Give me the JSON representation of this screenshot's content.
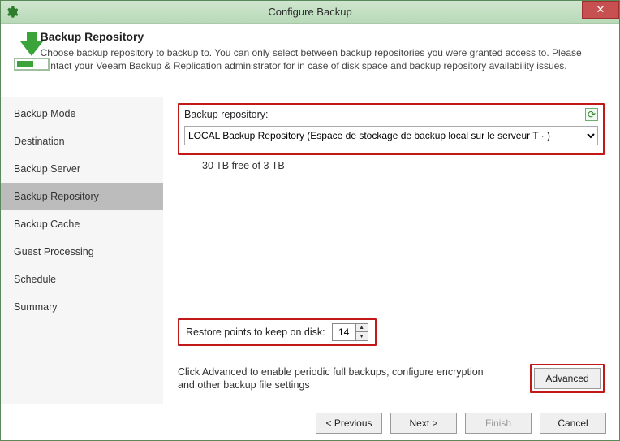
{
  "window": {
    "title": "Configure Backup"
  },
  "header": {
    "title": "Backup Repository",
    "description": "Choose backup repository to backup to. You can only select between backup repositories you were granted access to. Please contact your Veeam Backup & Replication administrator for in case of disk space and backup repository availability issues."
  },
  "sidebar": {
    "items": [
      {
        "label": "Backup Mode"
      },
      {
        "label": "Destination"
      },
      {
        "label": "Backup Server"
      },
      {
        "label": "Backup Repository"
      },
      {
        "label": "Backup Cache"
      },
      {
        "label": "Guest Processing"
      },
      {
        "label": "Schedule"
      },
      {
        "label": "Summary"
      }
    ],
    "active_index": 3
  },
  "repo": {
    "label": "Backup repository:",
    "selected": "LOCAL Backup Repository (Espace de stockage de backup local sur le serveur T                         · )",
    "free_text": "30    TB free of 3     TB"
  },
  "restore": {
    "label": "Restore points to keep on disk:",
    "value": "14"
  },
  "advanced": {
    "hint": "Click Advanced to enable periodic full backups, configure encryption and other backup file settings",
    "button": "Advanced"
  },
  "footer": {
    "previous": "< Previous",
    "next": "Next >",
    "finish": "Finish",
    "cancel": "Cancel"
  }
}
